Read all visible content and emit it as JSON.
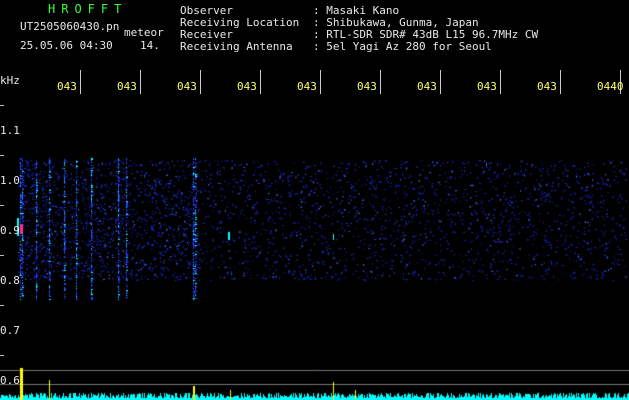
{
  "app": {
    "name": "HROFFT",
    "filename": "UT2505060430.pn",
    "mode": "meteor",
    "datetime": "25.05.06 04:30",
    "count": "14."
  },
  "info": {
    "labels": [
      "Observer",
      "Receiving Location",
      "Receiver",
      "Receiving Antenna"
    ],
    "values": [
      ": Masaki Kano",
      ": Shibukawa, Gunma, Japan",
      ": RTL-SDR SDR# 43dB L15 96.7MHz CW",
      ": 5el Yagi Az 280 for Seoul"
    ]
  },
  "axis": {
    "unit": "kHz",
    "time_ticks": [
      "043",
      "043",
      "043",
      "043",
      "043",
      "043",
      "043",
      "043",
      "043",
      "0440"
    ],
    "freq_ticks": [
      "1.1",
      "1.0",
      "0.9",
      "0.8",
      "0.7",
      "0.6"
    ]
  },
  "colors": {
    "background": "#000000",
    "header_text": "#e8e8e8",
    "title_green": "#33ff33",
    "time_tick_yellow": "#ffff66",
    "signal_blue": "#2a3cff",
    "signal_cyan": "#00ffff",
    "meteor_magenta": "#ff2d8a",
    "level_yellow": "#ffff00"
  }
}
